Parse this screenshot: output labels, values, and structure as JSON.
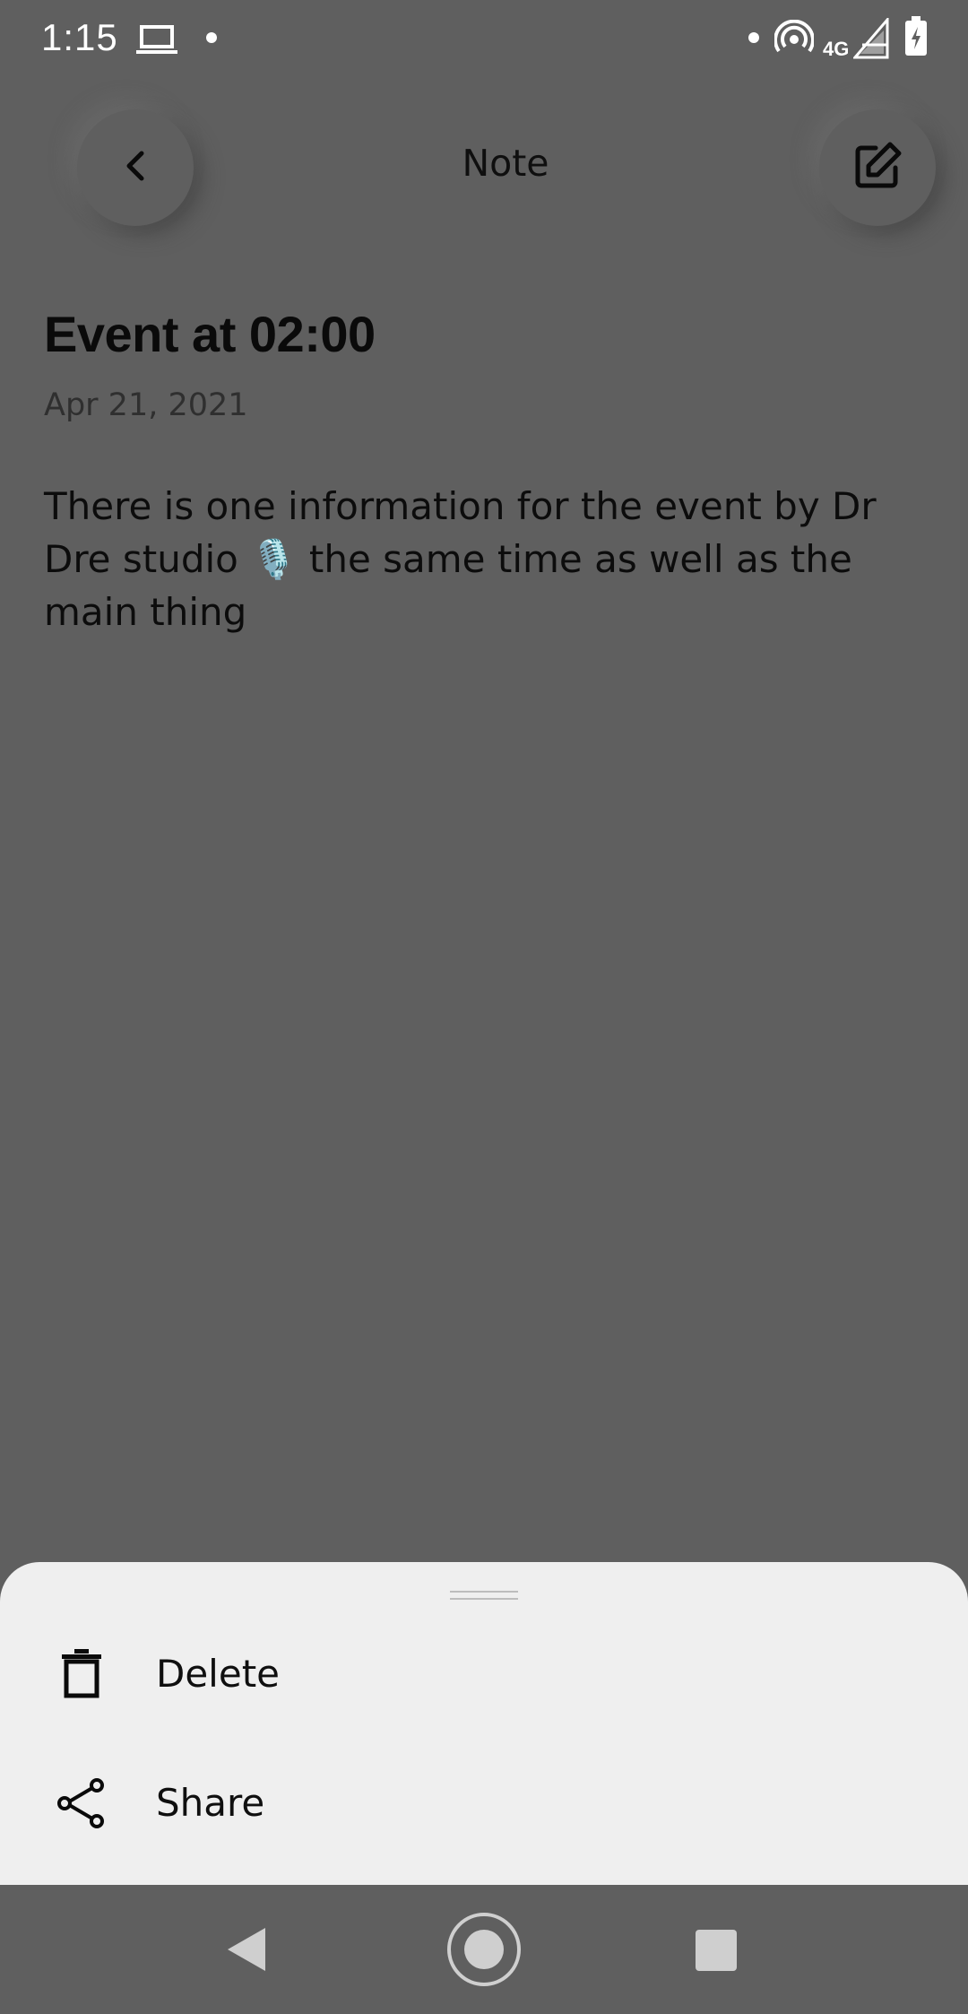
{
  "status_bar": {
    "time": "1:15",
    "network": "4G",
    "icons": [
      "laptop-icon",
      "notification-dot-icon",
      "hotspot-icon",
      "signal-icon",
      "battery-charging-icon"
    ]
  },
  "app_bar": {
    "title": "Note",
    "back_icon": "chevron-left-icon",
    "edit_icon": "edit-icon"
  },
  "note": {
    "title": "Event at 02:00",
    "date": "Apr 21, 2021",
    "body": "There is one information for the event by Dr Dre studio 🎙️ the same time as well as the main thing"
  },
  "sheet": {
    "items": [
      {
        "label": "Delete",
        "icon": "trash-icon"
      },
      {
        "label": "Share",
        "icon": "share-icon"
      }
    ]
  },
  "nav_bar": {
    "icons": [
      "back-triangle-icon",
      "home-circle-icon",
      "recents-square-icon"
    ]
  },
  "colors": {
    "scrim_background": "#5f5f5f",
    "sheet_background": "#efefef",
    "text_primary": "#0f0f0f"
  }
}
